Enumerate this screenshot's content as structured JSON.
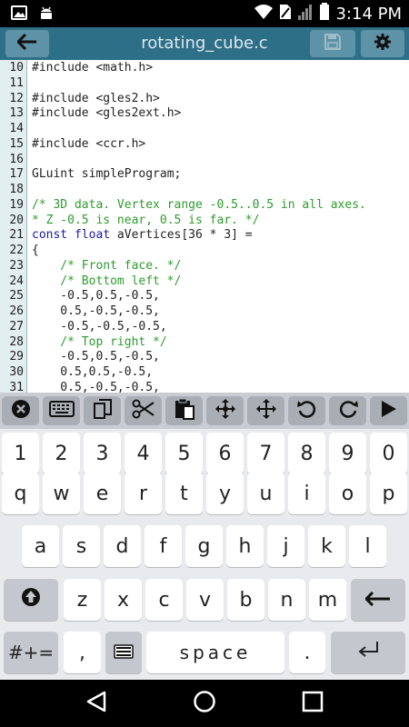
{
  "status_bar": {
    "time": "3:14 PM",
    "icons": [
      "image-notification-icon",
      "android-debug-icon",
      "wifi-icon",
      "no-sim-icon",
      "signal-icon",
      "battery-icon"
    ]
  },
  "app_bar": {
    "title": "rotating_cube.c",
    "back_icon": "arrow-left-icon",
    "save_icon": "floppy-disk-icon",
    "settings_icon": "gear-icon"
  },
  "editor": {
    "lines": [
      {
        "no": "10",
        "text": "#include <math.h>",
        "kind": "plain"
      },
      {
        "no": "11",
        "text": "",
        "kind": "plain"
      },
      {
        "no": "12",
        "text": "#include <gles2.h>",
        "kind": "plain"
      },
      {
        "no": "13",
        "text": "#include <gles2ext.h>",
        "kind": "plain"
      },
      {
        "no": "14",
        "text": "",
        "kind": "plain"
      },
      {
        "no": "15",
        "text": "#include <ccr.h>",
        "kind": "plain"
      },
      {
        "no": "16",
        "text": "",
        "kind": "plain"
      },
      {
        "no": "17",
        "text": "GLuint simpleProgram;",
        "kind": "plain"
      },
      {
        "no": "18",
        "text": "",
        "kind": "plain"
      },
      {
        "no": "19",
        "text": "/* 3D data. Vertex range -0.5..0.5 in all axes.",
        "kind": "comment"
      },
      {
        "no": "20",
        "text": "* Z -0.5 is near, 0.5 is far. */",
        "kind": "comment"
      },
      {
        "no": "21",
        "text": "const float aVertices[36 * 3] =",
        "kind": "keyword"
      },
      {
        "no": "22",
        "text": "{",
        "kind": "plain"
      },
      {
        "no": "23",
        "text": "    /* Front face. */",
        "kind": "comment"
      },
      {
        "no": "24",
        "text": "    /* Bottom left */",
        "kind": "comment"
      },
      {
        "no": "25",
        "text": "    -0.5,0.5,-0.5,",
        "kind": "plain"
      },
      {
        "no": "26",
        "text": "    0.5,-0.5,-0.5,",
        "kind": "plain"
      },
      {
        "no": "27",
        "text": "    -0.5,-0.5,-0.5,",
        "kind": "plain"
      },
      {
        "no": "28",
        "text": "    /* Top right */",
        "kind": "comment"
      },
      {
        "no": "29",
        "text": "    -0.5,0.5,-0.5,",
        "kind": "plain"
      },
      {
        "no": "30",
        "text": "    0.5,0.5,-0.5,",
        "kind": "plain"
      },
      {
        "no": "31",
        "text": "    0.5,-0.5,-0.5,",
        "kind": "plain"
      }
    ],
    "keyword_color": "#1a1aa6",
    "comment_color": "#2e9b2e"
  },
  "toolbar": {
    "buttons": [
      "close-circle-icon",
      "keyboard-icon",
      "copy-icon",
      "cut-icon",
      "paste-icon",
      "move-cursor-icon",
      "select-move-icon",
      "undo-icon",
      "redo-icon",
      "run-icon"
    ]
  },
  "keyboard": {
    "row_numbers": [
      "1",
      "2",
      "3",
      "4",
      "5",
      "6",
      "7",
      "8",
      "9",
      "0"
    ],
    "row_top": [
      "q",
      "w",
      "e",
      "r",
      "t",
      "y",
      "u",
      "i",
      "o",
      "p"
    ],
    "row_middle": [
      "a",
      "s",
      "d",
      "f",
      "g",
      "h",
      "j",
      "k",
      "l"
    ],
    "row_bottom": [
      "z",
      "x",
      "c",
      "v",
      "b",
      "n",
      "m"
    ],
    "symbols_label": "#+=",
    "comma_label": ",",
    "space_label": "space",
    "period_label": ".",
    "shift_icon": "shift-icon",
    "backspace_icon": "backspace-arrow-icon",
    "emoji_icon": "keyboard-layout-icon",
    "enter_icon": "enter-icon"
  },
  "nav_bar": {
    "icons": [
      "back-triangle-icon",
      "home-circle-icon",
      "recents-square-icon"
    ]
  }
}
